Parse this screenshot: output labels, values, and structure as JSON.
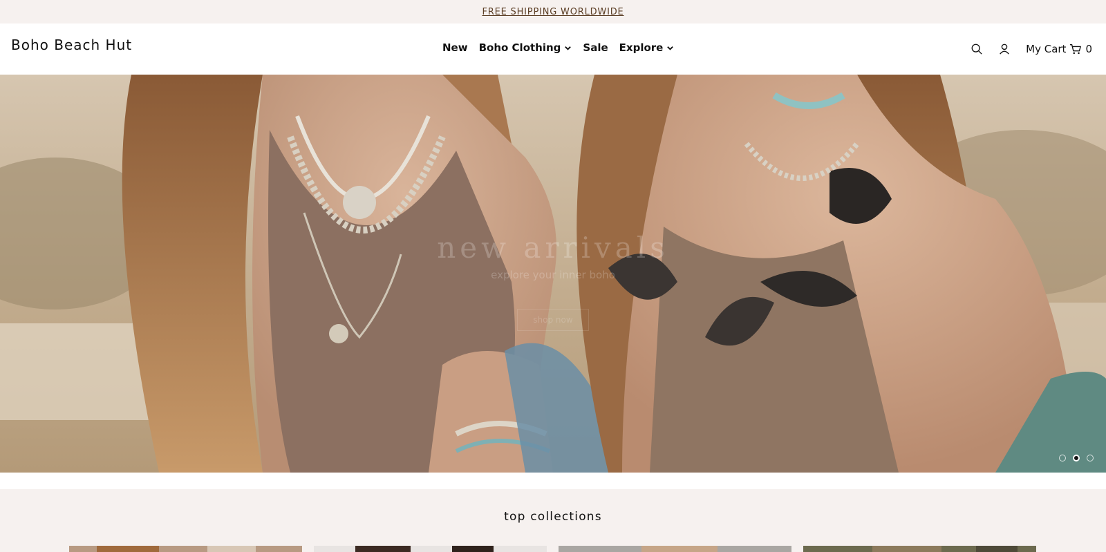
{
  "announcement": {
    "text": "FREE SHIPPING WORLDWIDE"
  },
  "header": {
    "logo": "Boho Beach Hut",
    "nav": [
      {
        "label": "New",
        "has_dropdown": false
      },
      {
        "label": "Boho Clothing",
        "has_dropdown": true
      },
      {
        "label": "Sale",
        "has_dropdown": false
      },
      {
        "label": "Explore",
        "has_dropdown": true
      }
    ],
    "icons": [
      "search-icon",
      "account-icon",
      "cart-icon"
    ],
    "cart_label": "My Cart",
    "cart_count": "0"
  },
  "hero": {
    "heading": "new arrivals",
    "subheading": "explore your inner boho",
    "button": "shop now",
    "slides_total": 3,
    "active_slide": 2
  },
  "collections": {
    "title": "top collections",
    "tiles": [
      "collection-tile-1",
      "collection-tile-2",
      "collection-tile-3",
      "collection-tile-4"
    ]
  },
  "colors": {
    "announcement_bg": "#f6f1ef",
    "announcement_text": "#5b3e25",
    "collections_bg": "#f6f1ef",
    "text": "#111111"
  }
}
